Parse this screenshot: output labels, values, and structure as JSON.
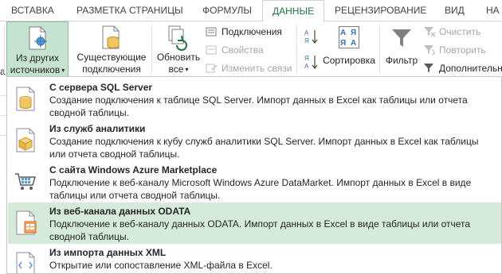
{
  "tabs": [
    {
      "label": "ВСТАВКА",
      "active": false
    },
    {
      "label": "РАЗМЕТКА СТРАНИЦЫ",
      "active": false
    },
    {
      "label": "ФОРМУЛЫ",
      "active": false
    },
    {
      "label": "ДАННЫЕ",
      "active": true
    },
    {
      "label": "РЕЦЕНЗИРОВАНИЕ",
      "active": false
    },
    {
      "label": "ВИД",
      "active": false
    },
    {
      "label": "НА",
      "active": false
    }
  ],
  "ribbon": {
    "from_other_sources": {
      "line1": "Из других",
      "line2": "источников",
      "caret": "▾"
    },
    "existing_connections": {
      "line1": "Существующие",
      "line2": "подключения"
    },
    "refresh_all": {
      "line1": "Обновить",
      "line2": "все",
      "caret": "▾"
    },
    "connections": "Подключения",
    "properties": "Свойства",
    "edit_links": "Изменить связи",
    "sort": "Сортировка",
    "sort_az_top": "А",
    "sort_az_bottom": "Я",
    "filter": "Фильтр",
    "clear": "Очистить",
    "reapply": "Повторить",
    "advanced": "Дополнительно"
  },
  "sheet": {
    "left_cell_fragment": "а",
    "cell_value": "12"
  },
  "menu": {
    "items": [
      {
        "title": "С сервера SQL Server",
        "description": "Создание подключения к таблице SQL Server. Импорт данных в Excel как таблицы или отчета сводной таблицы.",
        "icon": "sql-server-icon",
        "highlighted": false
      },
      {
        "title": "Из служб аналитики",
        "description": "Создание подключения к кубу служб аналитики SQL Server. Импорт данных в Excel как таблицы или отчета сводной таблицы.",
        "icon": "analysis-services-icon",
        "highlighted": false
      },
      {
        "title": "С сайта Windows Azure Marketplace",
        "description": "Подключение к веб-каналу Microsoft Windows Azure DataMarket. Импорт данных в Excel в виде таблицы или отчета сводной таблицы.",
        "icon": "azure-marketplace-cart-icon",
        "highlighted": false
      },
      {
        "title": "Из веб-канала данных ODATA",
        "description": "Подключение к веб-каналу данных ODATA. Импорт данных в Excel в виде таблицы или отчета сводной таблицы.",
        "icon": "odata-feed-icon",
        "highlighted": true
      },
      {
        "title": "Из импорта данных XML",
        "description": "Открытие или сопоставление XML-файла в Excel.",
        "icon": "xml-import-icon",
        "highlighted": false
      }
    ]
  },
  "colors": {
    "accent": "#217346",
    "highlight": "#d5eadb",
    "pressed": "#c6e3d1",
    "cylinder": "#f2c462"
  }
}
